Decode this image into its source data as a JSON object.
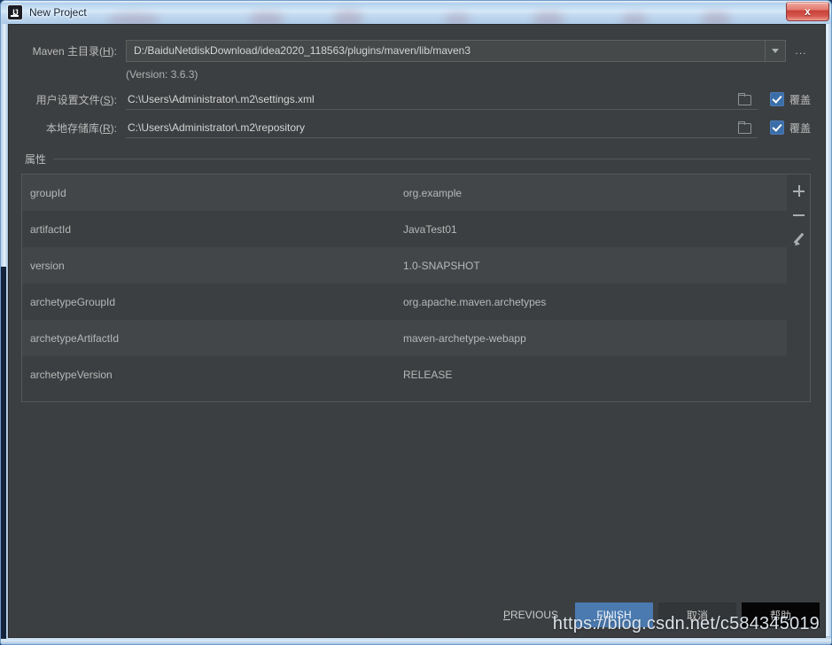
{
  "window": {
    "title": "New Project",
    "title_ghost": "",
    "close_label": "x",
    "app_icon": "intellij-idea-icon"
  },
  "form": {
    "maven_home": {
      "label_prefix": "Maven 主目录(",
      "label_mnemonic": "H",
      "label_suffix": "):",
      "value": "D:/BaiduNetdiskDownload/idea2020_118563/plugins/maven/lib/maven3",
      "dropdown_icon": "chevron-down-icon",
      "browse_label": "..."
    },
    "version_note": "(Version: 3.6.3)",
    "user_settings": {
      "label_prefix": "用户设置文件(",
      "label_mnemonic": "S",
      "label_suffix": "):",
      "value": "C:\\Users\\Administrator\\.m2\\settings.xml",
      "folder_icon": "folder-icon",
      "override_label": "覆盖",
      "override_checked": true
    },
    "local_repository": {
      "label_prefix": "本地存储库(",
      "label_mnemonic": "R",
      "label_suffix": "):",
      "value": "C:\\Users\\Administrator\\.m2\\repository",
      "folder_icon": "folder-icon",
      "override_label": "覆盖",
      "override_checked": true
    }
  },
  "properties": {
    "group_title": "属性",
    "rows": [
      {
        "key": "groupId",
        "value": "org.example"
      },
      {
        "key": "artifactId",
        "value": "JavaTest01"
      },
      {
        "key": "version",
        "value": "1.0-SNAPSHOT"
      },
      {
        "key": "archetypeGroupId",
        "value": "org.apache.maven.archetypes"
      },
      {
        "key": "archetypeArtifactId",
        "value": "maven-archetype-webapp"
      },
      {
        "key": "archetypeVersion",
        "value": "RELEASE"
      }
    ],
    "tools": {
      "add": "add-icon",
      "remove": "remove-icon",
      "edit": "edit-pencil-icon"
    }
  },
  "buttons": {
    "previous": {
      "mnemonic": "P",
      "rest": "REVIOUS"
    },
    "finish": {
      "prefix": "",
      "mnemonic": "F",
      "rest": "INISH"
    },
    "cancel": "取消",
    "help": "帮助"
  },
  "watermark": "https://blog.csdn.net/c584345019",
  "colors": {
    "dialog_bg": "#3c3f41",
    "row_alt": "#434649",
    "accent": "#4a7ab0",
    "checkbox": "#3b6ea8",
    "text": "#bbbbbb"
  }
}
